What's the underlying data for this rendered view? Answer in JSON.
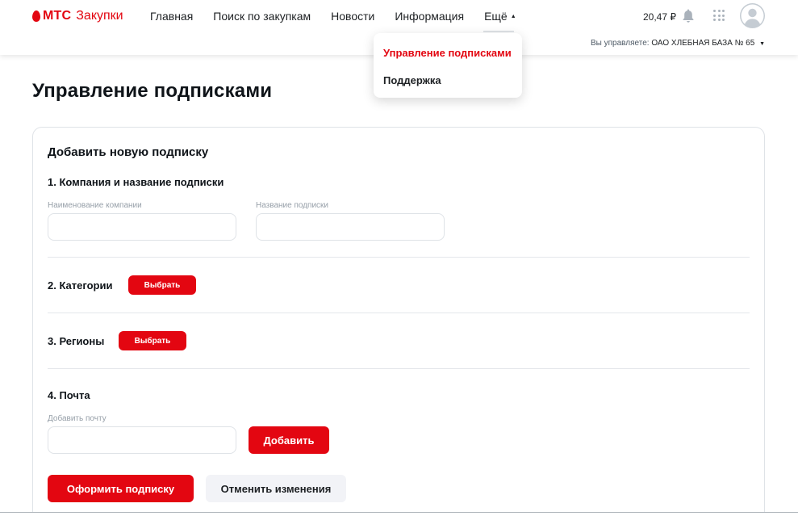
{
  "header": {
    "logo_brand": "МТС",
    "logo_sub": "Закупки",
    "nav": [
      {
        "label": "Главная"
      },
      {
        "label": "Поиск по закупкам"
      },
      {
        "label": "Новости"
      },
      {
        "label": "Информация"
      }
    ],
    "more_label": "Ещё",
    "balance": "20,47 ₽",
    "manager_label": "Вы управляете:",
    "manager_value": "ОАО ХЛЕБНАЯ БАЗА № 65",
    "icons": {
      "bell": "bell-icon",
      "apps": "apps-grid-icon",
      "avatar": "user-avatar-icon"
    }
  },
  "dropdown": {
    "items": [
      {
        "label": "Управление подписками"
      },
      {
        "label": "Поддержка"
      }
    ]
  },
  "page": {
    "title": "Управление подписками"
  },
  "form": {
    "title": "Добавить новую подписку",
    "section1": {
      "title": "1. Компания и название подписки",
      "company_label": "Наименование компании",
      "company_value": "",
      "subscription_label": "Название подписки",
      "subscription_value": ""
    },
    "section2": {
      "title": "2. Категории",
      "button": "Выбрать"
    },
    "section3": {
      "title": "3. Регионы",
      "button": "Выбрать"
    },
    "section4": {
      "title": "4. Почта",
      "email_label": "Добавить почту",
      "email_value": "",
      "add_button": "Добавить"
    },
    "submit_button": "Оформить подписку",
    "cancel_button": "Отменить изменения"
  },
  "colors": {
    "accent": "#e30611",
    "text": "#1d2023",
    "muted": "#969fa8",
    "border": "#dfe3e7"
  }
}
